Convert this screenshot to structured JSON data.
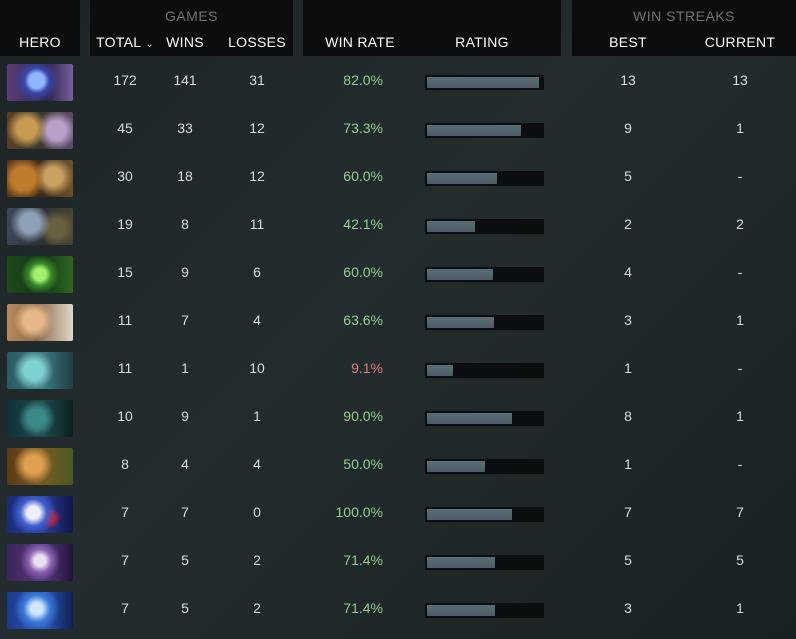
{
  "header": {
    "group_games": "GAMES",
    "group_win_streaks": "WIN STREAKS",
    "col_hero": "HERO",
    "col_total": "TOTAL",
    "col_wins": "WINS",
    "col_losses": "LOSSES",
    "col_win_rate": "WIN RATE",
    "col_rating": "RATING",
    "col_best": "BEST",
    "col_current": "CURRENT",
    "sort_icon": "chevron-down-icon"
  },
  "colors": {
    "win_rate_good": "#8fd08a",
    "win_rate_bad": "#e07c7c",
    "bar_fill": "#56666e",
    "header_bg": "#0b0d0e"
  },
  "rows": [
    {
      "total": "172",
      "wins": "141",
      "losses": "31",
      "win_rate": "82.0%",
      "rating": 0.97,
      "best": "13",
      "current": "13",
      "good": true
    },
    {
      "total": "45",
      "wins": "33",
      "losses": "12",
      "win_rate": "73.3%",
      "rating": 0.82,
      "best": "9",
      "current": "1",
      "good": true
    },
    {
      "total": "30",
      "wins": "18",
      "losses": "12",
      "win_rate": "60.0%",
      "rating": 0.61,
      "best": "5",
      "current": "-",
      "good": true
    },
    {
      "total": "19",
      "wins": "8",
      "losses": "11",
      "win_rate": "42.1%",
      "rating": 0.42,
      "best": "2",
      "current": "2",
      "good": true
    },
    {
      "total": "15",
      "wins": "9",
      "losses": "6",
      "win_rate": "60.0%",
      "rating": 0.57,
      "best": "4",
      "current": "-",
      "good": true
    },
    {
      "total": "11",
      "wins": "7",
      "losses": "4",
      "win_rate": "63.6%",
      "rating": 0.58,
      "best": "3",
      "current": "1",
      "good": true
    },
    {
      "total": "11",
      "wins": "1",
      "losses": "10",
      "win_rate": "9.1%",
      "rating": 0.23,
      "best": "1",
      "current": "-",
      "good": false
    },
    {
      "total": "10",
      "wins": "9",
      "losses": "1",
      "win_rate": "90.0%",
      "rating": 0.74,
      "best": "8",
      "current": "1",
      "good": true
    },
    {
      "total": "8",
      "wins": "4",
      "losses": "4",
      "win_rate": "50.0%",
      "rating": 0.5,
      "best": "1",
      "current": "-",
      "good": true
    },
    {
      "total": "7",
      "wins": "7",
      "losses": "0",
      "win_rate": "100.0%",
      "rating": 0.74,
      "best": "7",
      "current": "7",
      "good": true
    },
    {
      "total": "7",
      "wins": "5",
      "losses": "2",
      "win_rate": "71.4%",
      "rating": 0.59,
      "best": "5",
      "current": "5",
      "good": true
    },
    {
      "total": "7",
      "wins": "5",
      "losses": "2",
      "win_rate": "71.4%",
      "rating": 0.59,
      "best": "3",
      "current": "1",
      "good": true
    }
  ]
}
